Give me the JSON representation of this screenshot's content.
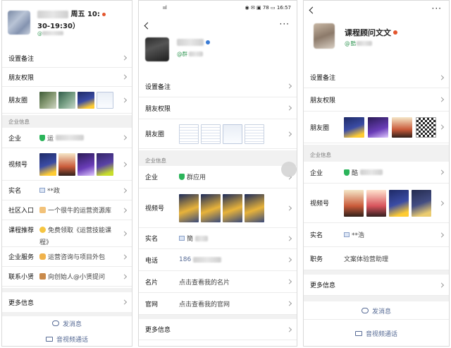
{
  "panel1": {
    "header": {
      "line1": "周五 10:",
      "line2": "30-19:30）",
      "name_at": "@"
    },
    "rows": [
      {
        "label": "设置备注"
      },
      {
        "label": "朋友权限"
      },
      {
        "label": "朋友圈"
      }
    ],
    "section": "企业信息",
    "company": {
      "label": "企业",
      "value": "运"
    },
    "channels": {
      "label": "视频号"
    },
    "realname": {
      "label": "实名",
      "value": "**政"
    },
    "community": {
      "label": "社区入口",
      "value": "一个很牛的运营资源库"
    },
    "course": {
      "label": "课程推荐",
      "value_line1": "免费领取《运营技能课",
      "value_line2": "程》"
    },
    "service": {
      "label": "企业服务",
      "value": "运营咨询与项目外包"
    },
    "contact": {
      "label": "联系小贤",
      "value": "向创始人@小贤提问"
    },
    "more": {
      "label": "更多信息"
    },
    "send": "发消息",
    "call": "音视频通话"
  },
  "panel2": {
    "status_time": "16:57",
    "status_battery": "78",
    "name_at": "@群",
    "rows": [
      {
        "label": "设置备注"
      },
      {
        "label": "朋友权限"
      },
      {
        "label": "朋友圈"
      }
    ],
    "section": "企业信息",
    "company": {
      "label": "企业",
      "value": "群应用"
    },
    "channels": {
      "label": "视频号"
    },
    "realname": {
      "label": "实名",
      "value": "簡"
    },
    "phone": {
      "label": "电话",
      "value": "186"
    },
    "card": {
      "label": "名片",
      "value": "点击查看我的名片"
    },
    "website": {
      "label": "官网",
      "value": "点击查看我的官网"
    },
    "more": {
      "label": "更多信息"
    }
  },
  "panel3": {
    "title": "课程顾问文文",
    "name_at": "@",
    "name_at_tail": "酷",
    "rows": [
      {
        "label": "设置备注"
      },
      {
        "label": "朋友权限"
      },
      {
        "label": "朋友圈"
      }
    ],
    "section": "企业信息",
    "company": {
      "label": "企业",
      "value": "酷"
    },
    "channels": {
      "label": "视频号"
    },
    "realname": {
      "label": "实名",
      "value": "**浩"
    },
    "title_row": {
      "label": "职务",
      "value": "文案体验营助理"
    },
    "more": {
      "label": "更多信息"
    },
    "send": "发消息",
    "call": "音视频通话"
  },
  "colors": {
    "link": "#576b95",
    "verified": "#2bb45a",
    "section_bg": "#f1f1f1"
  }
}
